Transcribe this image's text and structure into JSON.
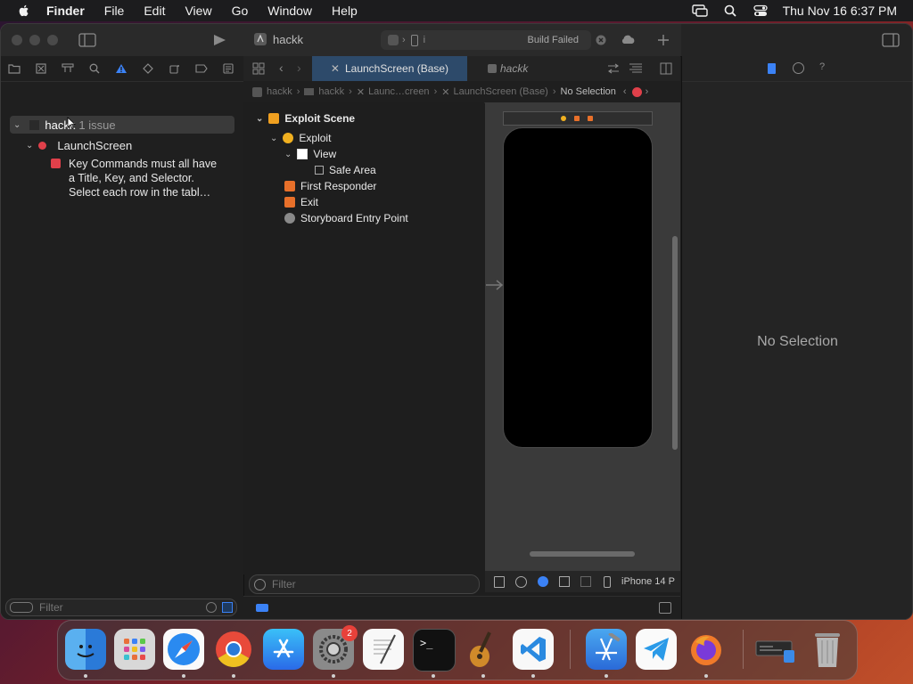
{
  "menubar": {
    "app": "Finder",
    "items": [
      "File",
      "Edit",
      "View",
      "Go",
      "Window",
      "Help"
    ],
    "datetime": "Thu Nov 16  6:37 PM"
  },
  "titlebar": {
    "project": "hackk",
    "build_status": "Build Failed"
  },
  "navigator": {
    "issue_project": "hackk",
    "issue_count": "1 issue",
    "file_name": "LaunchScreen",
    "issue_message_1": "Key Commands must all have",
    "issue_message_2": "a Title, Key, and Selector.",
    "issue_message_3": "Select each row in the tabl…",
    "filter_placeholder": "Filter"
  },
  "tabs": {
    "active": "LaunchScreen (Base)",
    "inactive": "hackk"
  },
  "jumpbar": {
    "items": [
      "hackk",
      "hackk",
      "Launc…creen",
      "LaunchScreen (Base)",
      "No Selection"
    ]
  },
  "outline": {
    "scene": "Exploit Scene",
    "controller": "Exploit",
    "view": "View",
    "safe_area": "Safe Area",
    "first_responder": "First Responder",
    "exit": "Exit",
    "entry_point": "Storyboard Entry Point",
    "filter_placeholder": "Filter"
  },
  "canvas": {
    "device": "iPhone 14 P"
  },
  "inspector": {
    "empty_label": "No Selection"
  },
  "dock": {
    "settings_badge": "2"
  },
  "colors": {
    "accent_blue": "#2d4a6a",
    "error_red": "#e0404a"
  }
}
